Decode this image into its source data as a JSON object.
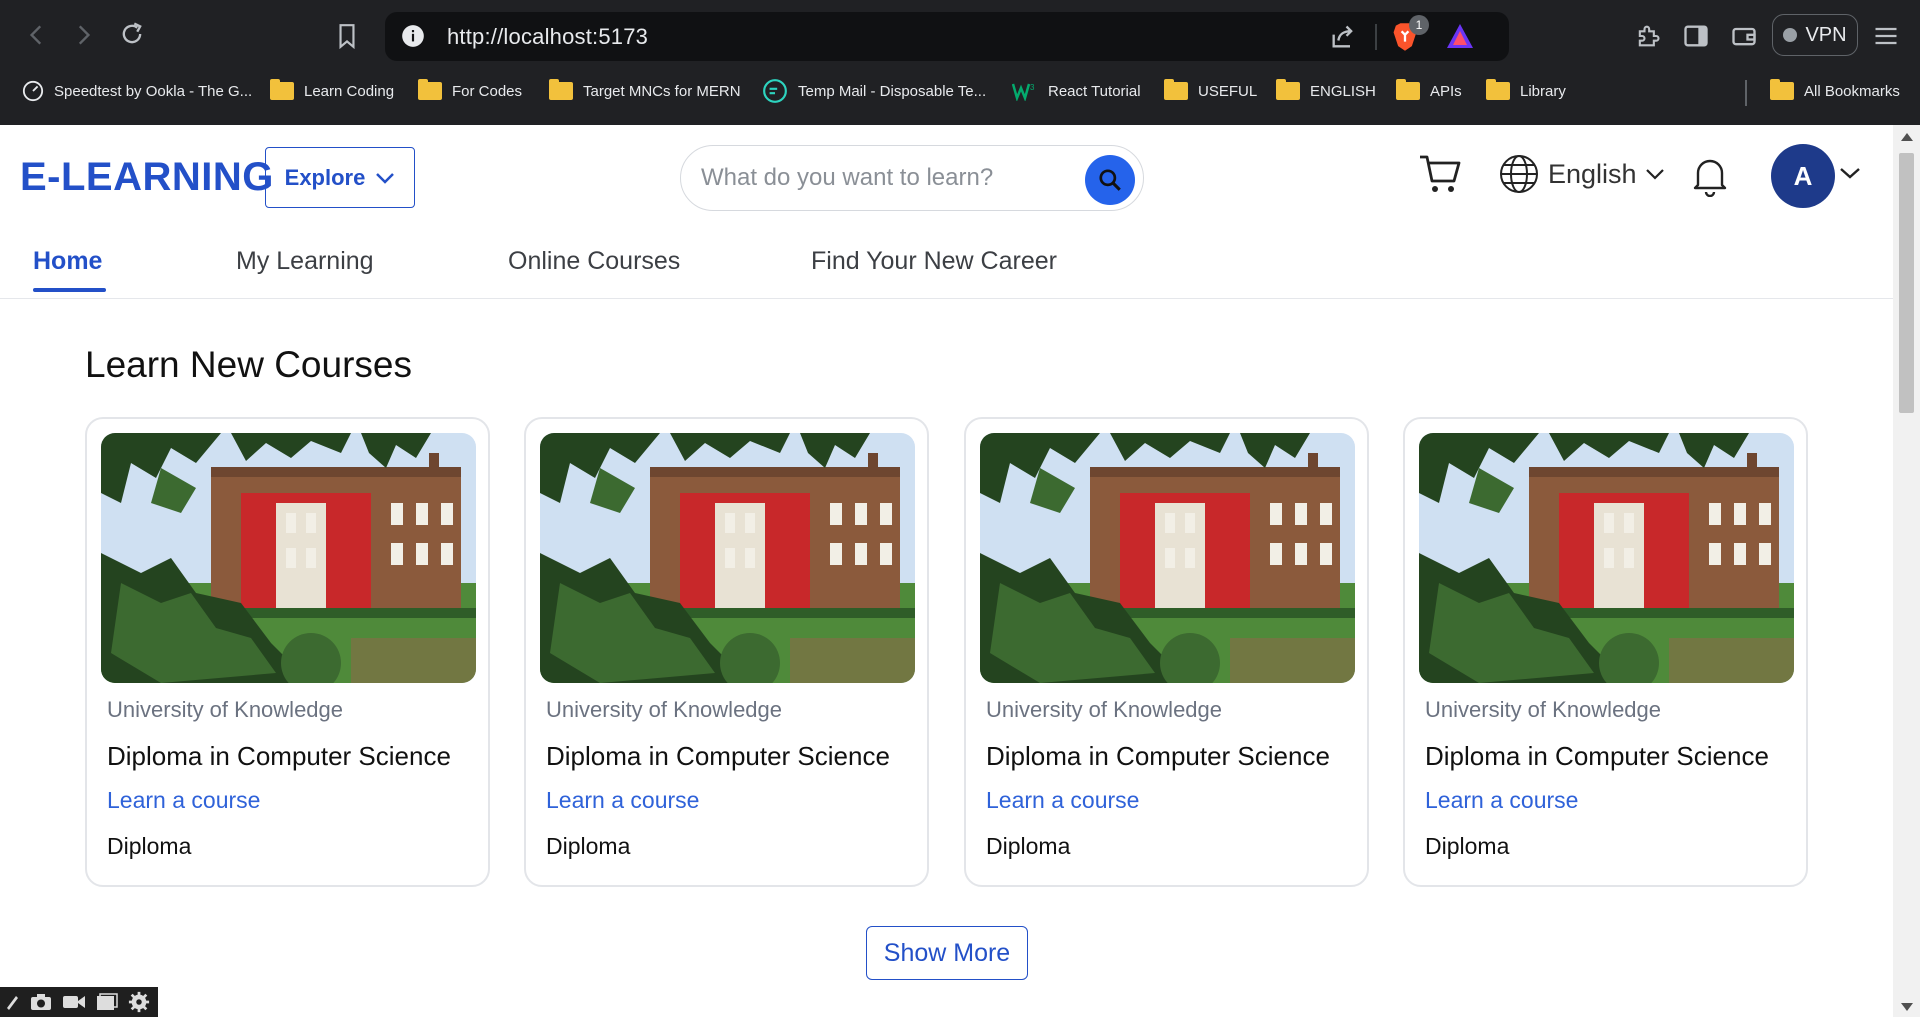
{
  "browser": {
    "url": "http://localhost:5173",
    "extension_badge": "1",
    "vpn_label": "VPN",
    "bookmarks": [
      {
        "label": "Speedtest by Ookla - The G...",
        "icon": "speedtest-icon"
      },
      {
        "label": "Learn Coding",
        "icon": "folder-icon"
      },
      {
        "label": "For Codes",
        "icon": "folder-icon"
      },
      {
        "label": "Target MNCs for MERN",
        "icon": "folder-icon"
      },
      {
        "label": "Temp Mail - Disposable Te...",
        "icon": "tempmail-icon"
      },
      {
        "label": "React Tutorial",
        "icon": "w3schools-icon"
      },
      {
        "label": "USEFUL",
        "icon": "folder-icon"
      },
      {
        "label": "ENGLISH",
        "icon": "folder-icon"
      },
      {
        "label": "APIs",
        "icon": "folder-icon"
      },
      {
        "label": "Library",
        "icon": "folder-icon"
      }
    ],
    "all_bookmarks": "All Bookmarks"
  },
  "header": {
    "logo": "E-LEARNING",
    "explore_label": "Explore",
    "search_placeholder": "What do you want to learn?",
    "language": "English",
    "avatar_initial": "A"
  },
  "nav": {
    "items": [
      {
        "label": "Home",
        "active": true
      },
      {
        "label": "My Learning",
        "active": false
      },
      {
        "label": "Online Courses",
        "active": false
      },
      {
        "label": "Find Your New Career",
        "active": false
      }
    ]
  },
  "main": {
    "section_title": "Learn New Courses",
    "courses": [
      {
        "university": "University of Knowledge",
        "title": "Diploma in Computer Science",
        "link": "Learn a course",
        "type": "Diploma"
      },
      {
        "university": "University of Knowledge",
        "title": "Diploma in Computer Science",
        "link": "Learn a course",
        "type": "Diploma"
      },
      {
        "university": "University of Knowledge",
        "title": "Diploma in Computer Science",
        "link": "Learn a course",
        "type": "Diploma"
      },
      {
        "university": "University of Knowledge",
        "title": "Diploma in Computer Science",
        "link": "Learn a course",
        "type": "Diploma"
      }
    ],
    "show_more": "Show More"
  },
  "colors": {
    "brand": "#2350c8",
    "search_button": "#2563eb",
    "avatar_bg": "#1e3a8a",
    "chrome_bg": "#202124"
  }
}
